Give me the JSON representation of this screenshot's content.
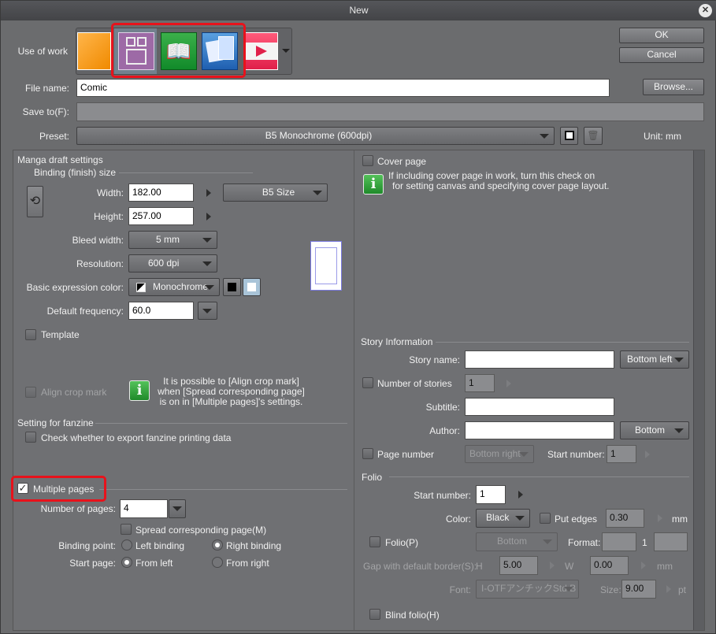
{
  "window": {
    "title": "New",
    "close": "✕"
  },
  "use_of_work": {
    "label": "Use of work",
    "icons": [
      "illustration-icon",
      "comic-icon",
      "webtoon-book-icon",
      "multi-page-icon",
      "animation-icon"
    ]
  },
  "buttons": {
    "ok": "OK",
    "cancel": "Cancel",
    "browse": "Browse..."
  },
  "file_name": {
    "label": "File name:",
    "value": "Comic"
  },
  "save_to": {
    "label": "Save to(F):",
    "value": ""
  },
  "preset": {
    "label": "Preset:",
    "value": "B5 Monochrome (600dpi)",
    "unit": "Unit: mm"
  },
  "manga": {
    "section": "Manga draft settings",
    "binding_size": "Binding (finish) size",
    "width_label": "Width:",
    "width": "182.00",
    "size_preset": "B5 Size",
    "height_label": "Height:",
    "height": "257.00",
    "bleed_label": "Bleed width:",
    "bleed": "5 mm",
    "resolution_label": "Resolution:",
    "resolution": "600 dpi",
    "color_label": "Basic expression color:",
    "color": "Monochrome",
    "freq_label": "Default frequency:",
    "freq": "60.0",
    "template": "Template",
    "align_crop": "Align crop mark",
    "align_info": [
      "It is possible to [Align crop mark]",
      "when [Spread corresponding page]",
      "is on in [Multiple pages]'s settings."
    ]
  },
  "fanzine": {
    "section": "Setting for fanzine",
    "check": "Check whether to export fanzine printing data"
  },
  "multiple": {
    "label": "Multiple pages",
    "checked": true,
    "num_label": "Number of pages:",
    "num": "4",
    "spread": "Spread corresponding page(M)",
    "binding_label": "Binding point:",
    "left_binding": "Left binding",
    "right_binding": "Right binding",
    "binding_selected": "Right binding",
    "start_label": "Start page:",
    "from_left": "From left",
    "from_right": "From right",
    "start_selected": "From left"
  },
  "cover": {
    "label": "Cover page",
    "info": [
      "If including cover page in work, turn this check on",
      "for setting canvas and specifying cover page layout."
    ]
  },
  "story": {
    "section": "Story Information",
    "name_label": "Story name:",
    "name": "",
    "name_pos": "Bottom left",
    "num_label": "Number of stories",
    "num": "1",
    "subtitle_label": "Subtitle:",
    "subtitle": "",
    "author_label": "Author:",
    "author": "",
    "author_pos": "Bottom",
    "page_number": "Page number",
    "page_pos": "Bottom right",
    "start_label": "Start number:",
    "start": "1"
  },
  "folio": {
    "section": "Folio",
    "start_label": "Start number:",
    "start": "1",
    "color_label": "Color:",
    "color": "Black",
    "edges": "Put edges",
    "edges_val": "0.30",
    "mm": "mm",
    "folio_label": "Folio(P)",
    "folio_pos": "Bottom",
    "format_label": "Format:",
    "format_mid": "1",
    "gap_label": "Gap with default border(S):",
    "h": "H",
    "h_val": "5.00",
    "w": "W",
    "w_val": "0.00",
    "font_label": "Font:",
    "font": "I-OTFアンチックStd B",
    "size_label": "Size:",
    "size": "9.00",
    "pt": "pt",
    "blind": "Blind folio(H)"
  },
  "colors": {
    "highlight": "#e8121b",
    "bg": "#6b6c6e"
  }
}
